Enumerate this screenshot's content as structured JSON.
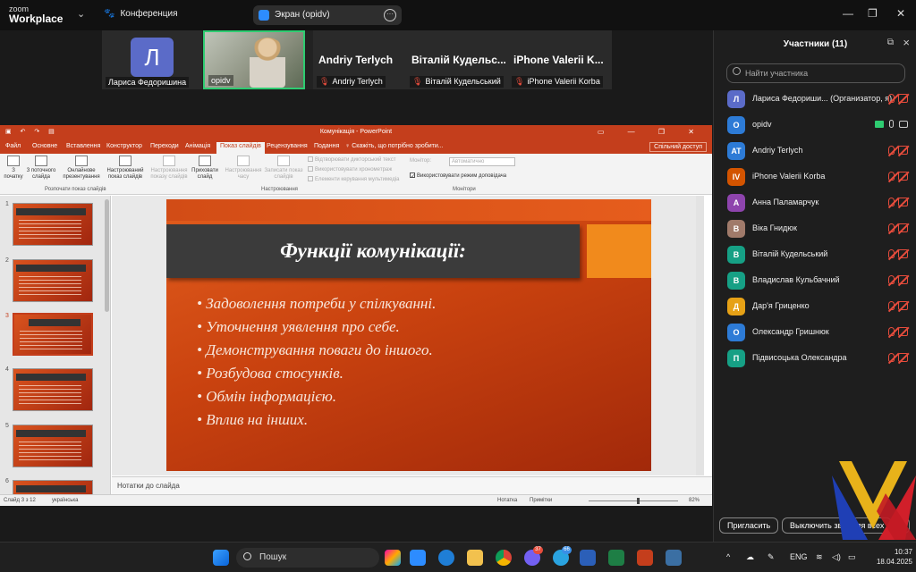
{
  "titlebar": {
    "logo_line1": "zoom",
    "logo_line2": "Workplace",
    "meeting_label": "Конференция",
    "share_label": "Экран (opidv)",
    "controls": [
      "—",
      "❐",
      "✕"
    ]
  },
  "video_strip": {
    "tiles": [
      {
        "name": "Лариса Федоришина",
        "initial": "Л"
      },
      {
        "name": "opidv"
      },
      {
        "big_name": "Andriy Terlych",
        "name": "Andriy Terlych"
      },
      {
        "big_name": "Віталій Кудельс...",
        "name": "Віталій Кудельський"
      },
      {
        "big_name": "iPhone Valerii K...",
        "name": "iPhone Valerii Korba"
      }
    ]
  },
  "powerpoint": {
    "window_title": "Комунікація - PowerPoint",
    "tabs": [
      "Файл",
      "Основне",
      "Вставлення",
      "Конструктор",
      "Переходи",
      "Анімація",
      "Показ слайдів",
      "Рецензування",
      "Подання",
      "♀ Скажіть, що потрібно зробити..."
    ],
    "active_tab": "Показ слайдів",
    "share_button": "Спільний доступ",
    "ribbon_buttons": [
      {
        "label": "З початку",
        "disabled": false
      },
      {
        "label": "З поточного слайда",
        "disabled": false
      },
      {
        "label": "Онлайнове презентування",
        "disabled": false
      },
      {
        "label": "Настроюваний показ слайдів",
        "disabled": false
      },
      {
        "label": "Настроювання показу слайдів",
        "disabled": true
      },
      {
        "label": "Приховати слайд",
        "disabled": false
      },
      {
        "label": "Настроювання часу",
        "disabled": true
      },
      {
        "label": "Записати показ слайдів",
        "disabled": true
      }
    ],
    "ribbon_checks": [
      {
        "label": "Відтворювати дикторський текст",
        "checked": false
      },
      {
        "label": "Використовувати хронометраж",
        "checked": false
      },
      {
        "label": "Елементи керування мультимедіа",
        "checked": false
      },
      {
        "label": "Використовувати режим доповідача",
        "checked": true
      }
    ],
    "monitor_label": "Монітор:",
    "monitor_value": "Автоматично",
    "groups": [
      "Розпочати показ слайдів",
      "Настроювання",
      "Монітори"
    ],
    "thumb_numbers": [
      "1",
      "2",
      "3",
      "4",
      "5",
      "6"
    ],
    "selected_thumb": 3,
    "slide": {
      "title": "Функції комунікації:",
      "bullets": [
        "Задоволення потреби у спілкуванні.",
        "Уточнення уявлення про себе.",
        "Демонстрування поваги до іншого.",
        "Розбудова стосунків.",
        "Обмін інформацією.",
        "Вплив на інших."
      ]
    },
    "notes_placeholder": "Нотатки до слайда",
    "status": {
      "slide_counter": "Слайд 3 з 12",
      "language": "українська",
      "notes_btn": "Нотатка",
      "comments_btn": "Примітки",
      "zoom": "82%"
    }
  },
  "participants": {
    "title": "Участники (11)",
    "search_placeholder": "Найти участника",
    "list": [
      {
        "initial": "Л",
        "name": "Лариса Федориши...  (Организатор, я)",
        "color": "#5b6bc8",
        "mic": "off",
        "cam": "off"
      },
      {
        "initial": "O",
        "name": "opidv",
        "color": "#2d7bd6",
        "mic": "on",
        "cam": "on",
        "sharing": true
      },
      {
        "initial": "AT",
        "name": "Andriy Terlych",
        "color": "#2d7bd6",
        "mic": "off",
        "cam": "off"
      },
      {
        "initial": "IV",
        "name": "iPhone Valerii Korba",
        "color": "#d35400",
        "mic": "off",
        "cam": "off"
      },
      {
        "initial": "А",
        "name": "Анна Паламарчук",
        "color": "#8e44ad",
        "mic": "off",
        "cam": "off"
      },
      {
        "initial": "В",
        "name": "Віка Гнидюк",
        "color": "#a07a6a",
        "mic": "off",
        "cam": "off"
      },
      {
        "initial": "В",
        "name": "Віталій Кудельський",
        "color": "#16a085",
        "mic": "off",
        "cam": "off"
      },
      {
        "initial": "В",
        "name": "Владислав Кульбачний",
        "color": "#16a085",
        "mic": "off",
        "cam": "off"
      },
      {
        "initial": "Д",
        "name": "Дар'я Гриценко",
        "color": "#e6a116",
        "mic": "off",
        "cam": "off"
      },
      {
        "initial": "О",
        "name": "Олександр Гришнюк",
        "color": "#2d7bd6",
        "mic": "off",
        "cam": "off"
      },
      {
        "initial": "П",
        "name": "Підвисоцька Олександра",
        "color": "#16a085",
        "mic": "off",
        "cam": "off"
      }
    ],
    "invite_button": "Пригласить",
    "mute_all_button": "Выключить звук для всех",
    "more_button": "···"
  },
  "taskbar": {
    "search_label": "Пошук",
    "badges": {
      "viber": "37",
      "telegram": "66"
    },
    "lang": "ENG",
    "time": "10:37",
    "date": "18.04.2025"
  }
}
